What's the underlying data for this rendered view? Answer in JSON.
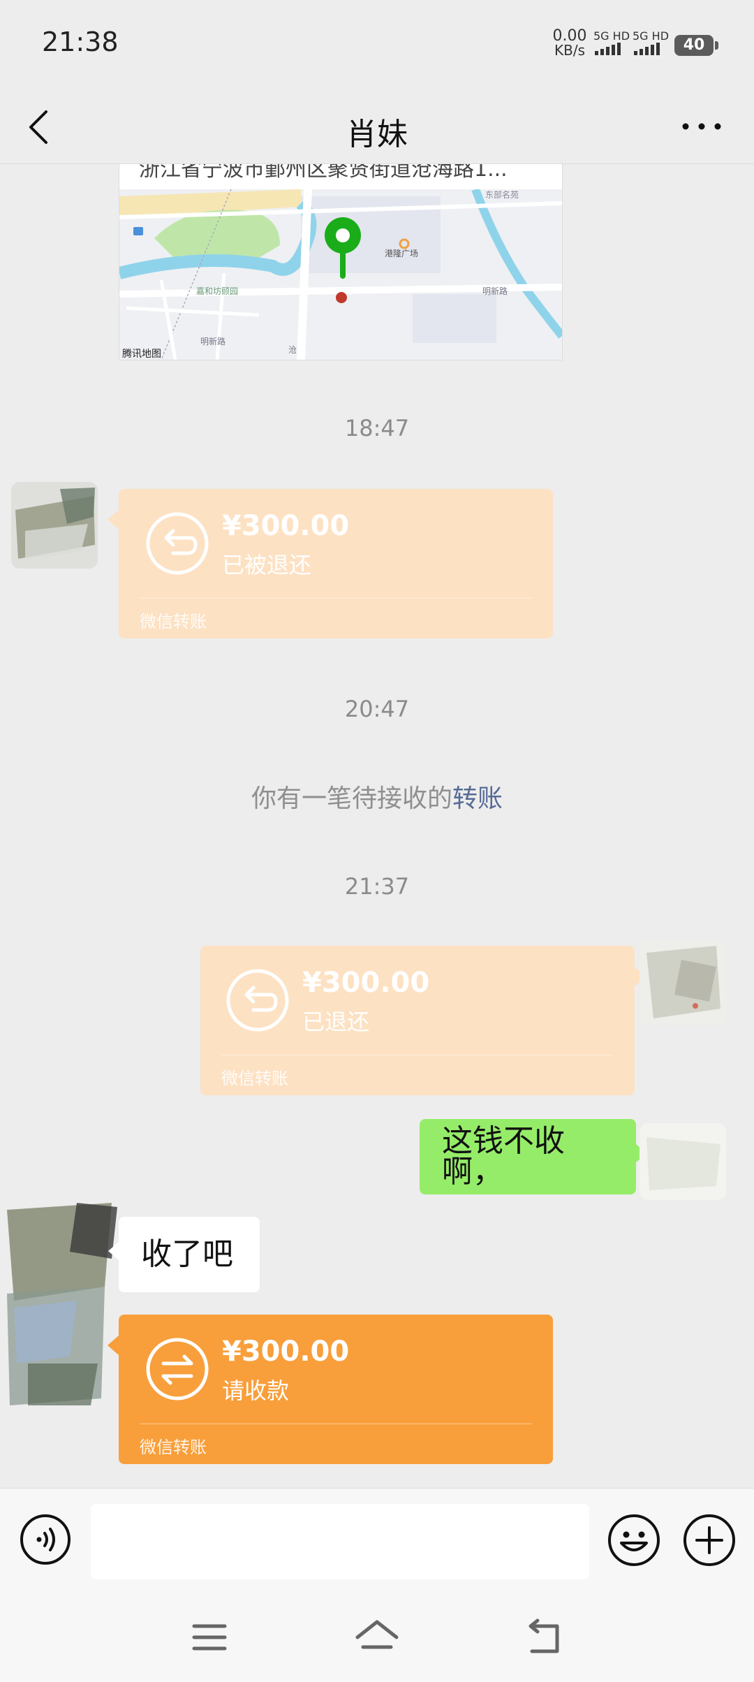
{
  "status_bar": {
    "time": "21:38",
    "net_speed": "0.00",
    "net_unit": "KB/s",
    "signal_1": "5G HD",
    "signal_2": "5G HD",
    "battery": "40"
  },
  "header": {
    "title": "肖妹",
    "back_icon": "back-arrow-icon",
    "more_icon": "more-dots-icon"
  },
  "messages": {
    "location": {
      "address": "浙江省宁波市鄞州区聚贤街道沧海路1...",
      "map_labels": {
        "poi_1": "港隆广场",
        "road_1": "明新路",
        "road_2": "明新路",
        "area": "嘉和坊颐园",
        "corner": "东部名苑",
        "road_3": "沧",
        "brand": "腾讯地图"
      }
    },
    "ts1": "18:47",
    "transfer1": {
      "amount": "¥300.00",
      "status": "已被退还",
      "footer": "微信转账",
      "icon": "return-arrow-icon"
    },
    "ts2": "20:47",
    "system_notice": {
      "text": "你有一笔待接收的",
      "link": "转账"
    },
    "ts3": "21:37",
    "transfer2": {
      "amount": "¥300.00",
      "status": "已退还",
      "footer": "微信转账",
      "icon": "return-arrow-icon"
    },
    "bubble_me": "这钱不收啊，",
    "bubble_them": "收了吧",
    "transfer3": {
      "amount": "¥300.00",
      "status": "请收款",
      "footer": "微信转账",
      "icon": "transfer-arrows-icon"
    }
  },
  "input_bar": {
    "text_value": "",
    "voice_icon": "voice-icon",
    "emoji_icon": "emoji-icon",
    "plus_icon": "plus-icon"
  },
  "nav_bar": {
    "menu_icon": "menu-icon",
    "home_icon": "home-icon",
    "back_icon": "back-icon"
  },
  "colors": {
    "background": "#ededed",
    "transfer_pale": "#fde1c3",
    "transfer_active": "#f89f3b",
    "bubble_me": "#95ec69",
    "link": "#576b95"
  }
}
